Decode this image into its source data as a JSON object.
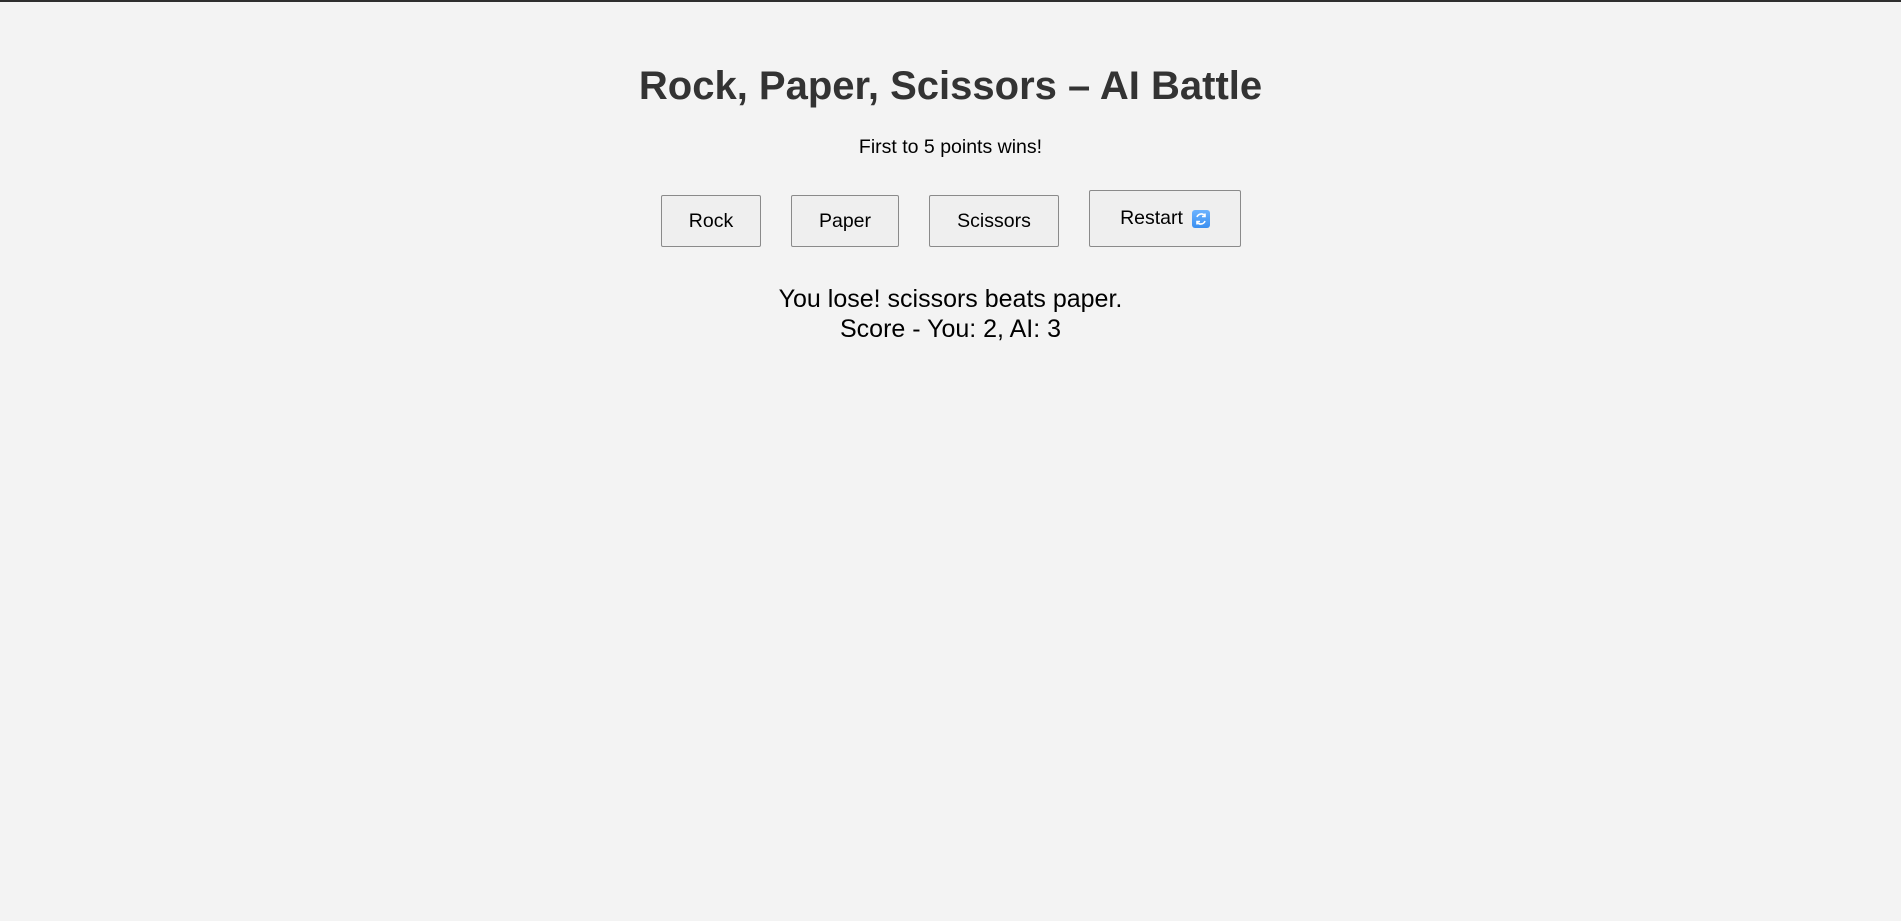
{
  "game": {
    "title": "Rock, Paper, Scissors – AI Battle",
    "subtitle": "First to 5 points wins!"
  },
  "controls": {
    "rock_label": "Rock",
    "paper_label": "Paper",
    "scissors_label": "Scissors",
    "restart_label": "Restart",
    "restart_icon": "refresh-icon"
  },
  "result": {
    "message": "You lose! scissors beats paper.",
    "score": "Score - You: 2, AI: 3"
  },
  "colors": {
    "background": "#f3f3f3",
    "title": "#333333",
    "button_bg": "#efefef",
    "restart_icon": "#3a8ff0"
  }
}
